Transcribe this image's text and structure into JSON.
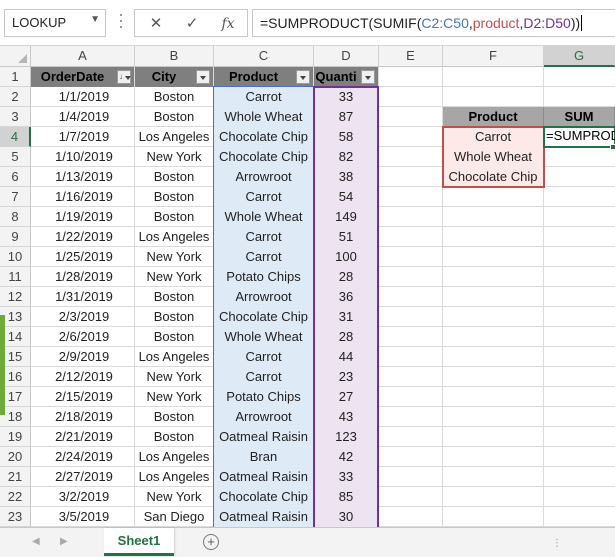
{
  "formula_bar": {
    "name_box": "LOOKUP",
    "formula_parts": [
      {
        "text": "=SUMPRODUCT(SUMIF(",
        "color": "#222222"
      },
      {
        "text": "C2:C50",
        "color": "#4472c4"
      },
      {
        "text": ",",
        "color": "#222222"
      },
      {
        "text": "product",
        "color": "#c0504d"
      },
      {
        "text": ",",
        "color": "#222222"
      },
      {
        "text": "D2:D50",
        "color": "#7030a0"
      },
      {
        "text": "))",
        "color": "#222222"
      }
    ],
    "icons": [
      "cancel-icon",
      "enter-icon",
      "fx-icon"
    ],
    "cancel_symbol": "✕",
    "enter_symbol": "✓",
    "fx_symbol": "fx"
  },
  "columns": [
    "A",
    "B",
    "C",
    "D",
    "E",
    "F",
    "G"
  ],
  "selected_column": "G",
  "selected_row": 4,
  "row_numbers": [
    1,
    2,
    3,
    4,
    5,
    6,
    7,
    8,
    9,
    10,
    11,
    12,
    13,
    14,
    15,
    16,
    17,
    18,
    19,
    20,
    21,
    22,
    23
  ],
  "table": {
    "headers": [
      "OrderDate",
      "City",
      "Product",
      "Quanti"
    ],
    "rows": [
      [
        "1/1/2019",
        "Boston",
        "Carrot",
        "33"
      ],
      [
        "1/4/2019",
        "Boston",
        "Whole Wheat",
        "87"
      ],
      [
        "1/7/2019",
        "Los Angeles",
        "Chocolate Chip",
        "58"
      ],
      [
        "1/10/2019",
        "New York",
        "Chocolate Chip",
        "82"
      ],
      [
        "1/13/2019",
        "Boston",
        "Arrowroot",
        "38"
      ],
      [
        "1/16/2019",
        "Boston",
        "Carrot",
        "54"
      ],
      [
        "1/19/2019",
        "Boston",
        "Whole Wheat",
        "149"
      ],
      [
        "1/22/2019",
        "Los Angeles",
        "Carrot",
        "51"
      ],
      [
        "1/25/2019",
        "New York",
        "Carrot",
        "100"
      ],
      [
        "1/28/2019",
        "New York",
        "Potato Chips",
        "28"
      ],
      [
        "1/31/2019",
        "Boston",
        "Arrowroot",
        "36"
      ],
      [
        "2/3/2019",
        "Boston",
        "Chocolate Chip",
        "31"
      ],
      [
        "2/6/2019",
        "Boston",
        "Whole Wheat",
        "28"
      ],
      [
        "2/9/2019",
        "Los Angeles",
        "Carrot",
        "44"
      ],
      [
        "2/12/2019",
        "New York",
        "Carrot",
        "23"
      ],
      [
        "2/15/2019",
        "New York",
        "Potato Chips",
        "27"
      ],
      [
        "2/18/2019",
        "Boston",
        "Arrowroot",
        "43"
      ],
      [
        "2/21/2019",
        "Boston",
        "Oatmeal Raisin",
        "123"
      ],
      [
        "2/24/2019",
        "Los Angeles",
        "Bran",
        "42"
      ],
      [
        "2/27/2019",
        "Los Angeles",
        "Oatmeal Raisin",
        "33"
      ],
      [
        "3/2/2019",
        "New York",
        "Chocolate Chip",
        "85"
      ],
      [
        "3/5/2019",
        "San Diego",
        "Oatmeal Raisin",
        "30"
      ]
    ]
  },
  "lookup": {
    "headers": [
      "Product",
      "SUM"
    ],
    "products": [
      "Carrot",
      "Whole Wheat",
      "Chocolate Chip"
    ],
    "active_cell_text": "=SUMPRODUCT"
  },
  "sheet_tabs": {
    "active": "Sheet1",
    "add_symbol": "+"
  },
  "colors": {
    "excel_green": "#217346",
    "product_range_blue": "#4472c4",
    "named_range_red": "#c0504d",
    "sum_range_purple": "#7030a0",
    "header_fill": "#7f7f7f"
  }
}
